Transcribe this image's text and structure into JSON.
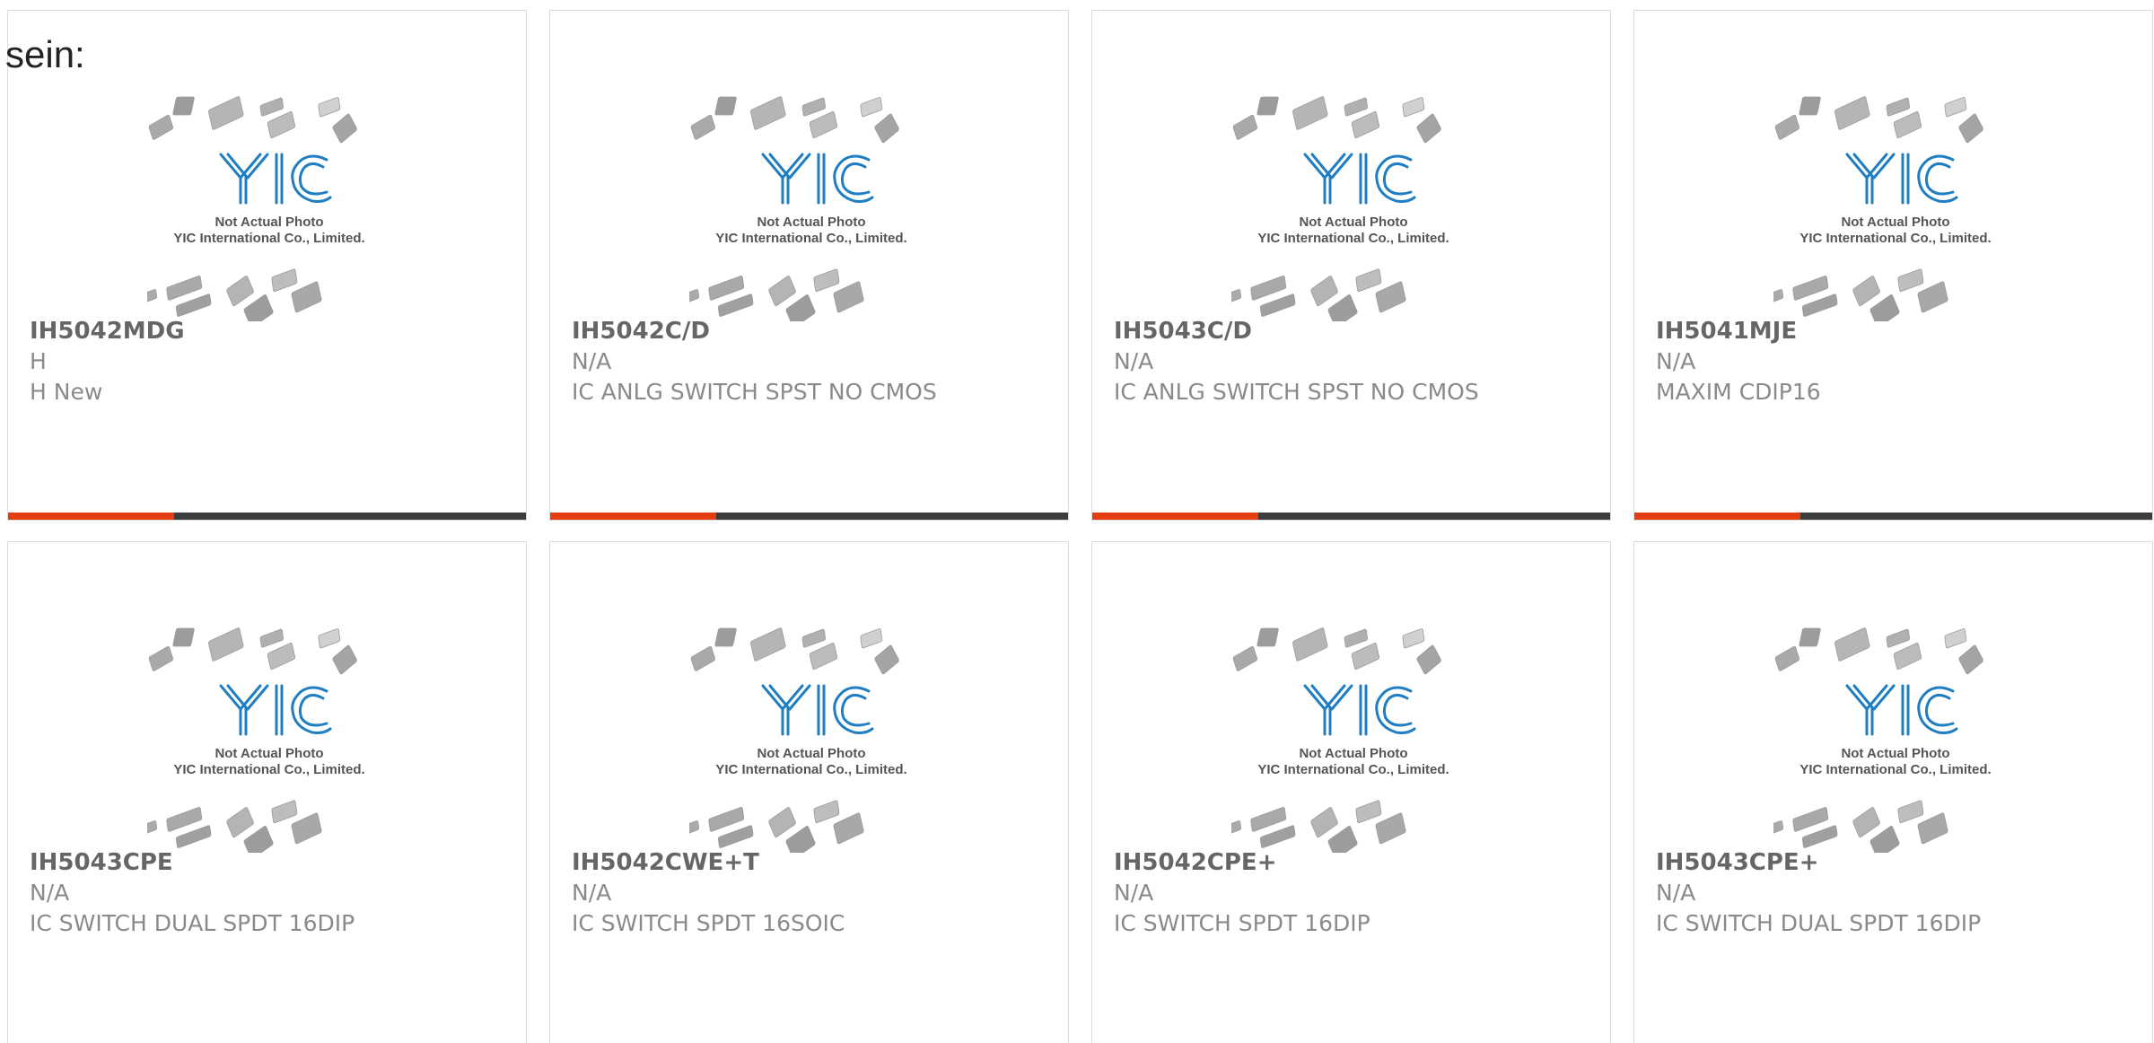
{
  "intro_text": "sein:",
  "placeholder_image": {
    "line1": "Not Actual Photo",
    "line2": "YIC International Co., Limited.",
    "logo_text": "YIC",
    "logo_color": "#1f7ec2"
  },
  "accent_bar": {
    "accent_color": "#e53d12",
    "base_color": "#3d3d3d",
    "accent_fraction": 0.32
  },
  "products": [
    {
      "part": "IH5042MDG",
      "manufacturer": "H",
      "description": "H New"
    },
    {
      "part": "IH5042C/D",
      "manufacturer": "N/A",
      "description": "IC ANLG SWITCH SPST NO CMOS"
    },
    {
      "part": "IH5043C/D",
      "manufacturer": "N/A",
      "description": "IC ANLG SWITCH SPST NO CMOS"
    },
    {
      "part": "IH5041MJE",
      "manufacturer": "N/A",
      "description": "MAXIM CDIP16"
    },
    {
      "part": "IH5043CPE",
      "manufacturer": "N/A",
      "description": "IC SWITCH DUAL SPDT 16DIP"
    },
    {
      "part": "IH5042CWE+T",
      "manufacturer": "N/A",
      "description": "IC SWITCH SPDT 16SOIC"
    },
    {
      "part": "IH5042CPE+",
      "manufacturer": "N/A",
      "description": "IC SWITCH SPDT 16DIP"
    },
    {
      "part": "IH5043CPE+",
      "manufacturer": "N/A",
      "description": "IC SWITCH DUAL SPDT 16DIP"
    }
  ]
}
